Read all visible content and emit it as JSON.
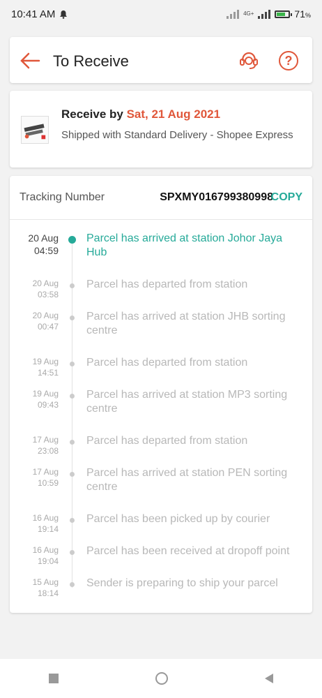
{
  "status_bar": {
    "time": "10:41 AM",
    "network": "4G+",
    "battery": "71",
    "battery_unit": "%"
  },
  "header": {
    "title": "To Receive",
    "icons": [
      "back-arrow-icon",
      "customer-support-icon",
      "help-icon"
    ],
    "help_symbol": "?"
  },
  "delivery": {
    "receive_prefix": "Receive by ",
    "receive_date": "Sat, 21 Aug 2021",
    "shipped_text": "Shipped with Standard Delivery  - Shopee Express"
  },
  "tracking": {
    "label": "Tracking Number",
    "number": "SPXMY016799380998",
    "copy_label": "COPY"
  },
  "events": [
    {
      "date": "20 Aug",
      "time": "04:59",
      "text": "Parcel has arrived at station Johor Jaya Hub",
      "active": true
    },
    {
      "date": "20 Aug",
      "time": "03:58",
      "text": "Parcel has departed from station",
      "active": false
    },
    {
      "date": "20 Aug",
      "time": "00:47",
      "text": "Parcel has arrived at station JHB sorting centre",
      "active": false
    },
    {
      "date": "19 Aug",
      "time": "14:51",
      "text": "Parcel has departed from station",
      "active": false
    },
    {
      "date": "19 Aug",
      "time": "09:43",
      "text": "Parcel has arrived at station MP3 sorting centre",
      "active": false
    },
    {
      "date": "17 Aug",
      "time": "23:08",
      "text": "Parcel has departed from station",
      "active": false
    },
    {
      "date": "17 Aug",
      "time": "10:59",
      "text": "Parcel has arrived at station PEN sorting centre",
      "active": false
    },
    {
      "date": "16 Aug",
      "time": "19:14",
      "text": "Parcel has been picked up by courier",
      "active": false
    },
    {
      "date": "16 Aug",
      "time": "19:04",
      "text": "Parcel has been received at dropoff point",
      "active": false
    },
    {
      "date": "15 Aug",
      "time": "18:14",
      "text": "Sender is preparing to ship your parcel",
      "active": false
    }
  ],
  "colors": {
    "accent": "#e0573a",
    "teal": "#26aa99"
  }
}
